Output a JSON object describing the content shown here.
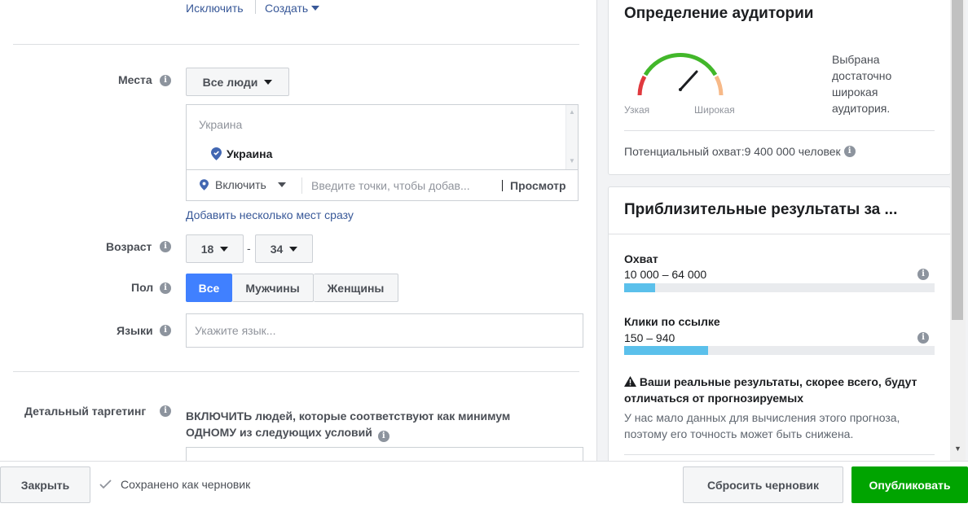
{
  "top": {
    "exclude_link": "Исключить",
    "create_link": "Создать"
  },
  "places": {
    "label": "Места",
    "dropdown": "Все люди",
    "list_header": "Украина",
    "list_item": "Украина",
    "include": "Включить",
    "search_placeholder": "Введите точки, чтобы добав...",
    "preview": "Просмотр",
    "add_multiple": "Добавить несколько мест сразу"
  },
  "age": {
    "label": "Возраст",
    "from": "18",
    "dash": "-",
    "to": "34"
  },
  "gender": {
    "label": "Пол",
    "options": [
      "Все",
      "Мужчины",
      "Женщины"
    ],
    "selected": "Все"
  },
  "languages": {
    "label": "Языки",
    "placeholder": "Укажите язык..."
  },
  "detailed": {
    "label": "Детальный таргетинг",
    "description": "ВКЛЮЧИТЬ людей, которые соответствуют как минимум ОДНОМУ из следующих условий"
  },
  "audience": {
    "title": "Определение аудитории",
    "gauge_left": "Узкая",
    "gauge_right": "Широкая",
    "message": "Выбрана достаточно широкая аудитория.",
    "potential": "Потенциальный охват:9 400 000 человек",
    "colors": {
      "narrow": "#e0393e",
      "ok": "#42b72a",
      "broad": "#f7b988"
    }
  },
  "results": {
    "title": "Приблизительные результаты за ...",
    "reach_label": "Охват",
    "reach_value": "10 000 – 64 000",
    "reach_fill": 0.1,
    "clicks_label": "Клики по ссылке",
    "clicks_value": "150 – 940",
    "clicks_fill": 0.27,
    "warning_title": "Ваши реальные результаты, скорее всего, будут отличаться от прогнозируемых",
    "warning_text": "У нас мало данных для вычисления этого прогноза, поэтому его точность может быть снижена."
  },
  "footer": {
    "close": "Закрыть",
    "saved": "Сохранено как черновик",
    "reset": "Сбросить черновик",
    "publish": "Опубликовать"
  }
}
